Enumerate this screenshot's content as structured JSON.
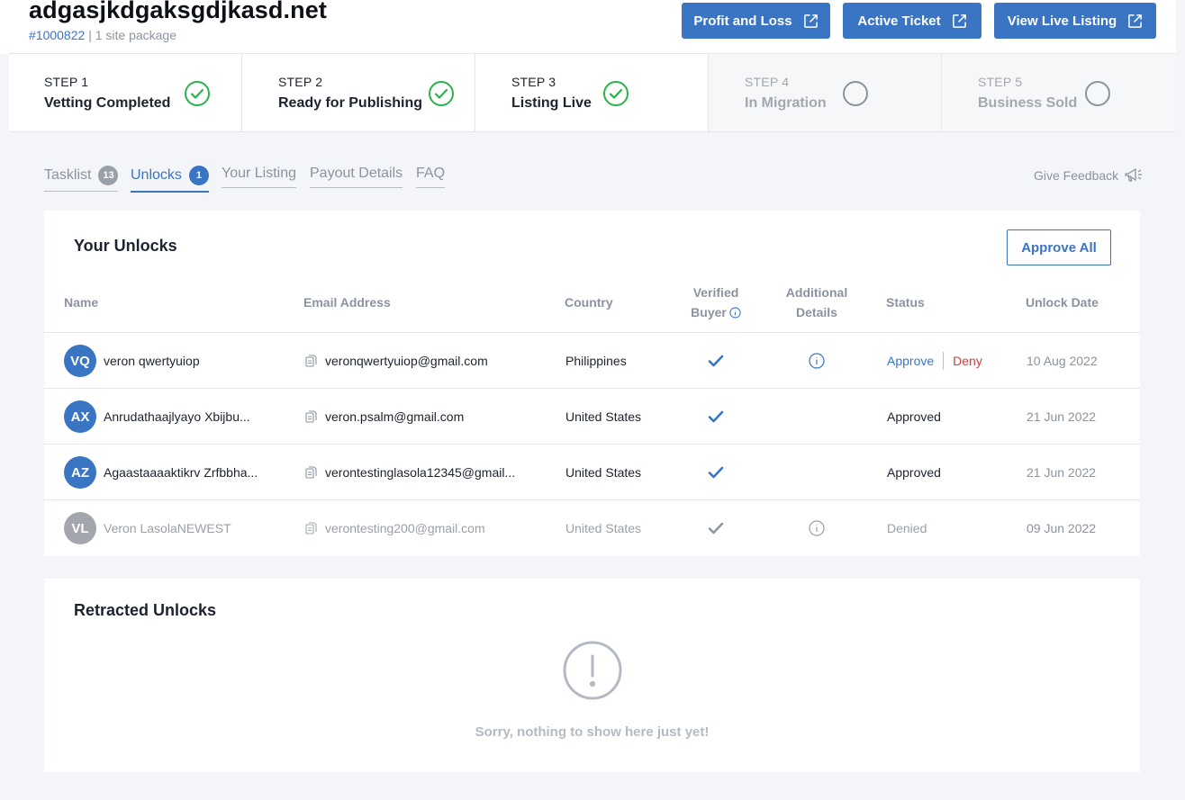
{
  "header": {
    "title": "adgasjkdgaksgdjkasd.net",
    "listing_id": "#1000822",
    "package": "| 1 site package",
    "buttons": {
      "profit_loss": "Profit and Loss",
      "active_ticket": "Active Ticket",
      "view_live": "View Live Listing"
    }
  },
  "steps": [
    {
      "num": "STEP 1",
      "label": "Vetting Completed",
      "done": true
    },
    {
      "num": "STEP 2",
      "label": "Ready for Publishing",
      "done": true
    },
    {
      "num": "STEP 3",
      "label": "Listing Live",
      "done": true
    },
    {
      "num": "STEP 4",
      "label": "In Migration",
      "done": false
    },
    {
      "num": "STEP 5",
      "label": "Business Sold",
      "done": false
    }
  ],
  "tabs": [
    {
      "label": "Tasklist",
      "badge": "13"
    },
    {
      "label": "Unlocks",
      "badge": "1"
    },
    {
      "label": "Your Listing"
    },
    {
      "label": "Payout Details"
    },
    {
      "label": "FAQ"
    }
  ],
  "feedback": "Give Feedback",
  "unlocks": {
    "title": "Your Unlocks",
    "approve_all": "Approve All",
    "columns": {
      "name": "Name",
      "email": "Email Address",
      "country": "Country",
      "verified_line1": "Verified",
      "verified_line2": "Buyer",
      "additional_line1": "Additional",
      "additional_line2": "Details",
      "status": "Status",
      "date": "Unlock Date"
    },
    "rows": [
      {
        "initials": "VQ",
        "name": "veron qwertyuiop",
        "email": "veronqwertyuiop@gmail.com",
        "country": "Philippines",
        "verified": true,
        "details": true,
        "approve": "Approve",
        "deny": "Deny",
        "status": "",
        "date": "10 Aug 2022"
      },
      {
        "initials": "AX",
        "name": "Anrudathaajlyayo Xbijbu...",
        "email": "veron.psalm@gmail.com",
        "country": "United States",
        "verified": true,
        "details": false,
        "approve": "",
        "deny": "",
        "status": "Approved",
        "date": "21 Jun 2022"
      },
      {
        "initials": "AZ",
        "name": "Agaastaaaaktikrv Zrfbbha...",
        "email": "verontestinglasola12345@gmail...",
        "country": "United States",
        "verified": true,
        "details": false,
        "approve": "",
        "deny": "",
        "status": "Approved",
        "date": "21 Jun 2022"
      },
      {
        "initials": "VL",
        "name": "Veron LasolaNEWEST",
        "email": "verontesting200@gmail.com",
        "country": "United States",
        "verified": true,
        "details": true,
        "approve": "",
        "deny": "",
        "status": "Denied",
        "date": "09 Jun 2022"
      }
    ]
  },
  "retracted": {
    "title": "Retracted Unlocks",
    "empty": "Sorry, nothing to show here just yet!"
  },
  "colors": {
    "accent": "#3a75c4",
    "success": "#2bb24c",
    "deny": "#d23a3a",
    "muted": "#8b93a1"
  }
}
